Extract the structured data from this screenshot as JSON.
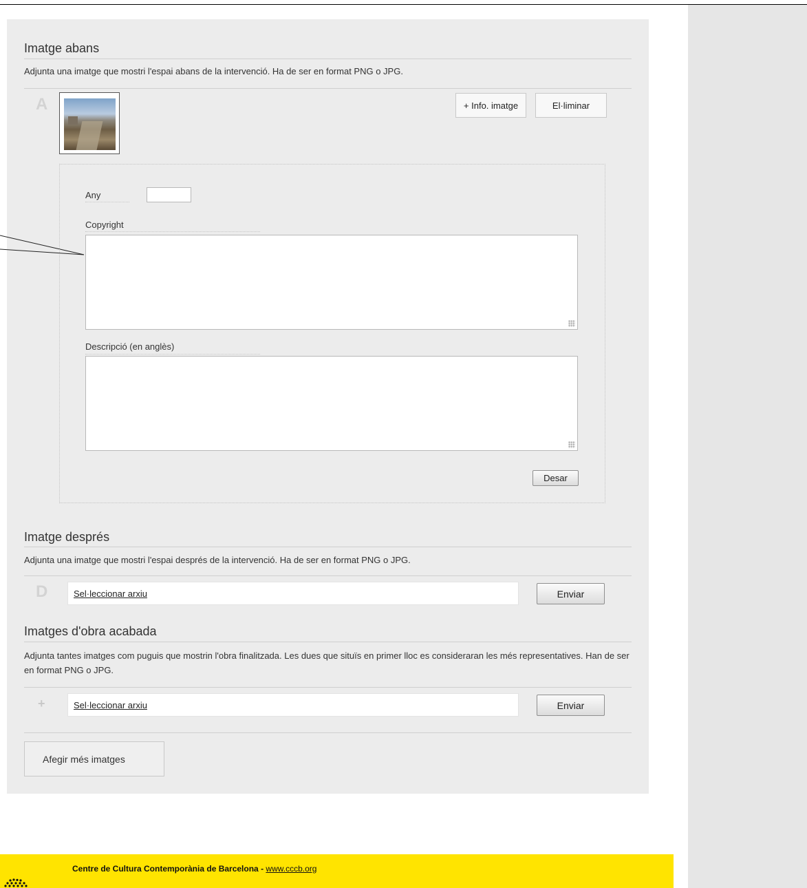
{
  "section_before": {
    "title": "Imatge abans",
    "description": "Adjunta una imatge que mostri l'espai abans de la intervenció. Ha de ser en format PNG o JPG.",
    "letter": "A",
    "info_button": "+ Info. imatge",
    "delete_button": "El·liminar",
    "form": {
      "year_label": "Any",
      "year_value": "",
      "copyright_label": "Copyright",
      "copyright_value": "",
      "description_label": "Descripció (en anglès)",
      "description_value": "",
      "save_button": "Desar"
    }
  },
  "section_after": {
    "title": "Imatge després",
    "description": "Adjunta una imatge que mostri l'espai després de la intervenció. Ha de ser en format PNG o JPG.",
    "letter": "D",
    "file_label": "Sel·leccionar arxiu",
    "send_button": "Enviar"
  },
  "section_finished": {
    "title": "Imatges d'obra acabada",
    "description": "Adjunta tantes imatges com puguis que mostrin l'obra finalitzada. Les dues que situïs en primer lloc es consideraran les més representatives. Han de ser en format PNG o JPG.",
    "plus": "+",
    "file_label": "Sel·leccionar arxiu",
    "send_button": "Enviar",
    "add_more_button": "Afegir més imatges"
  },
  "footer": {
    "org_name": "Centre de Cultura Contemporània de Barcelona",
    "separator": " - ",
    "link_text": "www.cccb.org",
    "logo_color": "#111111"
  },
  "colors": {
    "panel_bg": "#ececec",
    "sidebar_bg": "#e6e6e6",
    "footer_bg": "#ffe400"
  }
}
